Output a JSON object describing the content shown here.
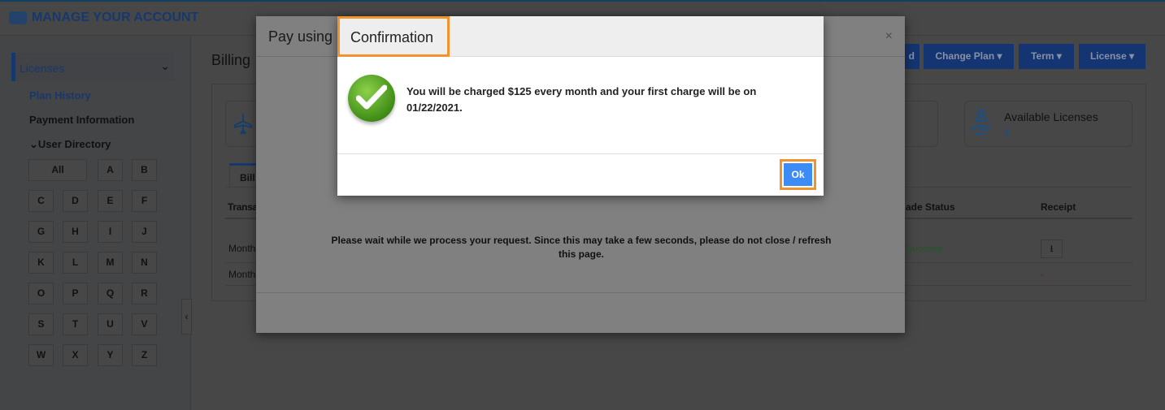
{
  "header": {
    "title": "MANAGE YOUR ACCOUNT"
  },
  "sidebar": {
    "licenses": "Licenses",
    "plan_history": "Plan History",
    "payment_information": "Payment Information",
    "user_directory": "User Directory",
    "letters": [
      "All",
      "A",
      "B",
      "C",
      "D",
      "E",
      "F",
      "G",
      "H",
      "I",
      "J",
      "K",
      "L",
      "M",
      "N",
      "O",
      "P",
      "Q",
      "R",
      "S",
      "T",
      "U",
      "V",
      "W",
      "X",
      "Y",
      "Z"
    ]
  },
  "main": {
    "title": "Billing",
    "buttons": {
      "partial": "d",
      "change_plan": "Change Plan ▾",
      "term": "Term ▾",
      "license": "License ▾"
    },
    "available_licenses": {
      "label": "Available Licenses",
      "value": "4"
    },
    "tab": "Bill",
    "columns": {
      "transaction": "Transa",
      "upgrade_status": "ade Status",
      "receipt": "Receipt"
    },
    "rows": [
      {
        "transaction": "Month",
        "status": "Success",
        "receipt": "download"
      },
      {
        "transaction": "Month",
        "status": "",
        "receipt": "-"
      }
    ]
  },
  "pay_modal": {
    "title": "Pay using",
    "close": "×",
    "message": "Please wait while we process your request. Since this may take a few seconds, please do not close / refresh this page."
  },
  "confirmation": {
    "title": "Confirmation",
    "message": "You will be charged $125 every month and your first charge will be on 01/22/2021.",
    "ok": "Ok"
  },
  "colors": {
    "brand": "#1d4f9c",
    "highlight": "#f0922e",
    "ok_button": "#3d8bf5",
    "success": "#2e8b2e"
  }
}
